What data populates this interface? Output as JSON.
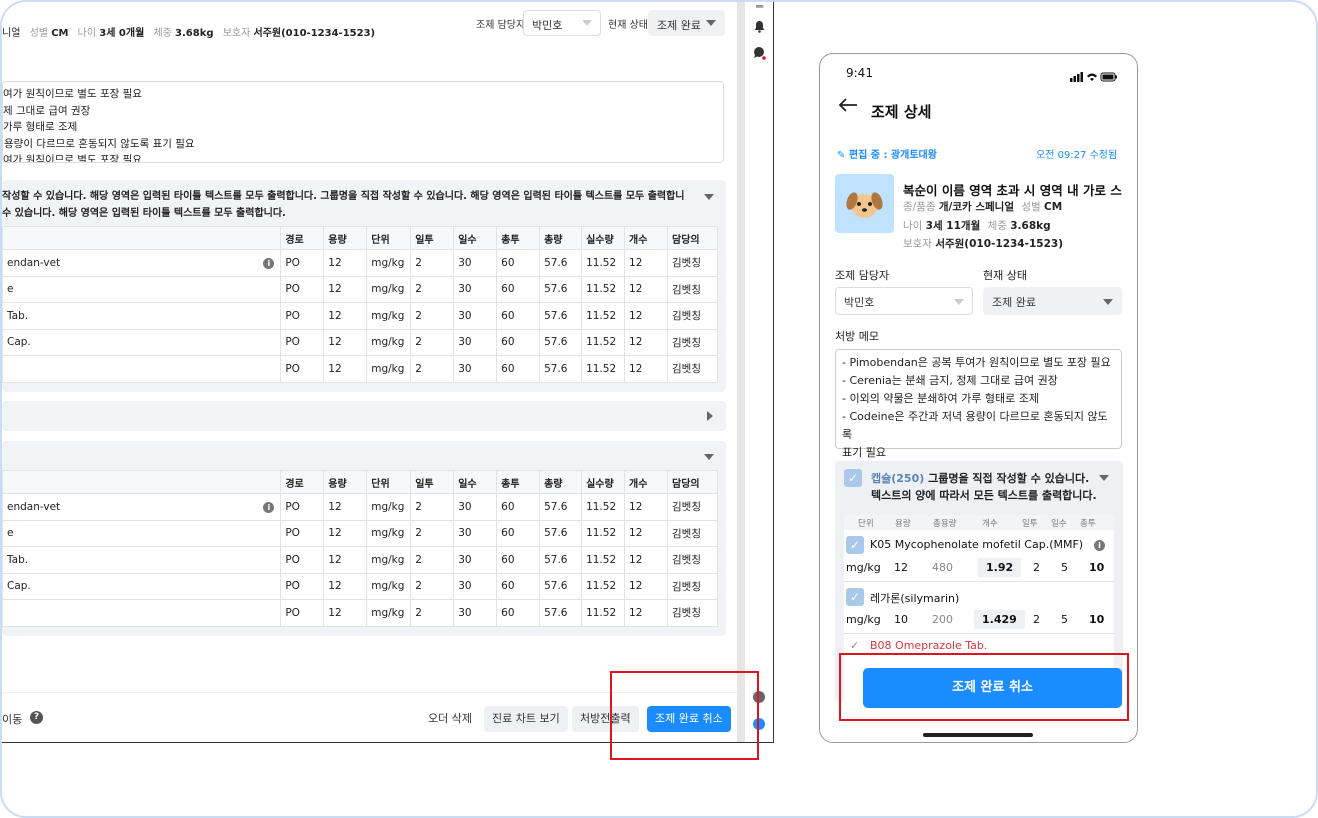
{
  "header": {
    "patient_line_start": "니얼",
    "sex_label": "성별",
    "sex_value": "CM",
    "age_label": "나이",
    "age_value": "3세 0개월",
    "weight_label": "체중",
    "weight_value": "3.68kg",
    "owner_label": "보호자",
    "owner_value": "서주원(010-1234-1523)",
    "pharmacist_label": "조제 담당자",
    "pharmacist_value": "박민호",
    "status_label": "현재 상태",
    "status_value": "조제 완료"
  },
  "memo_lines": [
    "여가 원칙이므로 별도 포장 필요",
    "제 그대로 급여 권장",
    "가루 형태로 조제",
    "용량이 다르므로 혼동되지 않도록 표기 필요",
    "여가 원칙이므로 별도 포장 필요"
  ],
  "group1": {
    "title_line1": "작성할 수 있습니다. 해당 영역은 입력된 타이틀 텍스트를 모두 출력합니다. 그룹명을 직접 작성할 수 있습니다. 해당 영역은 입력된 타이틀 텍스트를 모두 출력합니",
    "title_line2": "수 있습니다. 해당 영역은 입력된 타이틀 텍스트를 모두 출력합니다."
  },
  "table_headers": [
    "경로",
    "용량",
    "단위",
    "일투",
    "일수",
    "총투",
    "총량",
    "실수량",
    "개수",
    "담당의"
  ],
  "table1_rows": [
    {
      "name": "endan-vet",
      "info": true,
      "cells": [
        "PO",
        "12",
        "mg/kg",
        "2",
        "30",
        "60",
        "57.6",
        "11.52",
        "12",
        "김벳칭"
      ]
    },
    {
      "name": "e",
      "info": false,
      "cells": [
        "PO",
        "12",
        "mg/kg",
        "2",
        "30",
        "60",
        "57.6",
        "11.52",
        "12",
        "김벳칭"
      ]
    },
    {
      "name": "Tab.",
      "info": false,
      "cells": [
        "PO",
        "12",
        "mg/kg",
        "2",
        "30",
        "60",
        "57.6",
        "11.52",
        "12",
        "김벳칭"
      ]
    },
    {
      "name": "Cap.",
      "info": false,
      "cells": [
        "PO",
        "12",
        "mg/kg",
        "2",
        "30",
        "60",
        "57.6",
        "11.52",
        "12",
        "김벳칭"
      ]
    },
    {
      "name": "",
      "info": false,
      "cells": [
        "PO",
        "12",
        "mg/kg",
        "2",
        "30",
        "60",
        "57.6",
        "11.52",
        "12",
        "김벳칭"
      ]
    }
  ],
  "table2_rows": [
    {
      "name": "endan-vet",
      "info": true,
      "cells": [
        "PO",
        "12",
        "mg/kg",
        "2",
        "30",
        "60",
        "57.6",
        "11.52",
        "12",
        "김벳칭"
      ]
    },
    {
      "name": "e",
      "info": false,
      "cells": [
        "PO",
        "12",
        "mg/kg",
        "2",
        "30",
        "60",
        "57.6",
        "11.52",
        "12",
        "김벳칭"
      ]
    },
    {
      "name": "Tab.",
      "info": false,
      "cells": [
        "PO",
        "12",
        "mg/kg",
        "2",
        "30",
        "60",
        "57.6",
        "11.52",
        "12",
        "김벳칭"
      ]
    },
    {
      "name": "Cap.",
      "info": false,
      "cells": [
        "PO",
        "12",
        "mg/kg",
        "2",
        "30",
        "60",
        "57.6",
        "11.52",
        "12",
        "김벳칭"
      ]
    },
    {
      "name": "",
      "info": false,
      "cells": [
        "PO",
        "12",
        "mg/kg",
        "2",
        "30",
        "60",
        "57.6",
        "11.52",
        "12",
        "김벳칭"
      ]
    }
  ],
  "footer": {
    "move_label": "이동",
    "help_icon": "?",
    "delete_order": "오더 삭제",
    "view_chart": "진료 차트 보기",
    "print_prescription": "처방전출력",
    "cancel_complete": "조제 완료 취소"
  },
  "phone": {
    "time": "9:41",
    "title": "조제 상세",
    "editing": "편집 중 : 광개토대왕",
    "edited_time": "오전 09:27 수정됨",
    "pet_name": "복순이 이름 영역 초과 시 영역 내 가로 스",
    "breed_label": "종/품종",
    "breed_value": "개/코카 스페니얼",
    "sex_label": "성별",
    "sex_value": "CM",
    "age_label": "나이",
    "age_value": "3세 11개월",
    "weight_label": "체중",
    "weight_value": "3.68kg",
    "owner_label": "보호자",
    "owner_value": "서주원(010-1234-1523)",
    "pharmacist_label": "조제 담당자",
    "pharmacist_value": "박민호",
    "status_label": "현재 상태",
    "status_value": "조제 완료",
    "memo_label": "처방 메모",
    "memo_lines": [
      "- Pimobendan은 공복 투여가 원칙이므로 별도 포장 필요",
      "- Cerenia는 분쇄 금지, 정제 그대로 급여 권장",
      "- 이외의 약물은 분쇄하여 가루 형태로 조제",
      "- Codeine은 주간과 저녁 용량이 다르므로 혼동되지 않도록",
      "표기 필요"
    ],
    "group_count": "캡슐(250)",
    "group_title1": "그룹명을 직접 작성할 수 있습니다.",
    "group_title2": "텍스트의 양에 따라서 모든 텍스트를 출력합니다.",
    "col_headers": [
      "단위",
      "용량",
      "총용량",
      "개수",
      "일투",
      "일수",
      "총투"
    ],
    "drug1_name": "K05 Mycophenolate mofetil Cap.(MMF)",
    "drug1_vals": [
      "mg/kg",
      "12",
      "480",
      "1.92",
      "2",
      "5",
      "10"
    ],
    "drug2_name": "레가론(silymarin)",
    "drug2_vals": [
      "mg/kg",
      "10",
      "200",
      "1.429",
      "2",
      "5",
      "10"
    ],
    "drug3_name": "B08 Omeprazole Tab.",
    "cancel_button": "조제 완료 취소"
  },
  "colors": {
    "accent": "#1a8cff",
    "highlight_box": "#e0141e",
    "danger_text": "#d9363e"
  }
}
